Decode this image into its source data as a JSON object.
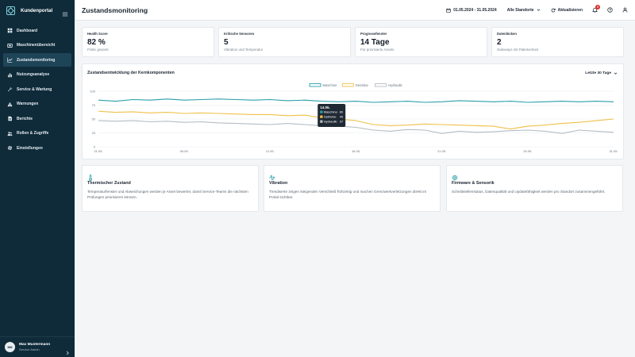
{
  "app": {
    "brand": "Kundenportal"
  },
  "sidebar": {
    "items": [
      {
        "label": "Dashboard",
        "icon": "grid-icon"
      },
      {
        "label": "Maschinenübersicht",
        "icon": "machine-icon"
      },
      {
        "label": "Zustandsmonitoring",
        "icon": "chart-line-icon"
      },
      {
        "label": "Nutzungsanalyse",
        "icon": "bar-chart-icon"
      },
      {
        "label": "Service & Wartung",
        "icon": "wrench-icon"
      },
      {
        "label": "Warnungen",
        "icon": "warning-icon"
      },
      {
        "label": "Berichte",
        "icon": "document-icon"
      },
      {
        "label": "Rollen & Zugriffe",
        "icon": "users-icon"
      },
      {
        "label": "Einstellungen",
        "icon": "gear-icon"
      }
    ],
    "active_index": 2,
    "user": {
      "initials": "MM",
      "name": "Max Mustermann",
      "role": "Service Admin"
    }
  },
  "header": {
    "title": "Zustandsmonitoring",
    "date_range": "01.05.2024 - 31.05.2024",
    "location": "Alle Standorte",
    "refresh": "Aktualisieren",
    "notifications": "3"
  },
  "kpis": [
    {
      "label": "Health Score",
      "value": "82 %",
      "sub": "Flotte gesamt"
    },
    {
      "label": "Kritische Sensoren",
      "value": "5",
      "sub": "Vibration und Temperatur"
    },
    {
      "label": "Prognosefenster",
      "value": "14 Tage",
      "sub": "Für priorisierte Assets"
    },
    {
      "label": "Datenlücken",
      "value": "2",
      "sub": "Gateways mit Paketverlust"
    }
  ],
  "chart_section": {
    "title": "Zustandsentwicklung der Kernkomponenten",
    "range": "Letzte 30 Tage"
  },
  "chart_data": {
    "type": "line",
    "title": "Zustandsentwicklung der Kernkomponenten",
    "x_ticks": [
      "01.05.",
      "06.05.",
      "11.05.",
      "16.05.",
      "21.05.",
      "26.05.",
      "31.05."
    ],
    "days": [
      1,
      2,
      3,
      4,
      5,
      6,
      7,
      8,
      9,
      10,
      11,
      12,
      13,
      14,
      15,
      16,
      17,
      18,
      19,
      20,
      21,
      22,
      23,
      24,
      25,
      26,
      27,
      28,
      29,
      30,
      31
    ],
    "ylim": [
      0,
      100
    ],
    "y_ticks": [
      0,
      25,
      50,
      75,
      100
    ],
    "grid": true,
    "legend_position": "top-center",
    "series": [
      {
        "name": "Maschine",
        "color": "#2a9fa8",
        "values": [
          84,
          82,
          85,
          84,
          86,
          84,
          85,
          86,
          85,
          84,
          85,
          83,
          84,
          82,
          81,
          82,
          80,
          81,
          82,
          80,
          81,
          83,
          82,
          81,
          82,
          80,
          81,
          82,
          81,
          82,
          81
        ]
      },
      {
        "name": "Getriebe",
        "color": "#efc14a",
        "values": [
          64,
          62,
          63,
          61,
          62,
          60,
          61,
          60,
          59,
          58,
          58,
          56,
          57,
          52,
          50,
          47,
          40,
          38,
          39,
          41,
          40,
          39,
          38,
          37,
          32,
          37,
          39,
          42,
          44,
          47,
          50
        ]
      },
      {
        "name": "Hydraulik",
        "color": "#b5bcc2",
        "values": [
          47,
          46,
          47,
          45,
          46,
          44,
          45,
          43,
          42,
          41,
          40,
          42,
          40,
          38,
          37,
          35,
          30,
          28,
          31,
          30,
          24,
          28,
          26,
          27,
          29,
          30,
          28,
          24,
          30,
          28,
          26
        ]
      }
    ],
    "tooltip": {
      "label": "14.05.",
      "rows": [
        {
          "name": "Maschine",
          "value": "80",
          "color": "#2a9fa8"
        },
        {
          "name": "Getriebe",
          "value": "49",
          "color": "#efc14a"
        },
        {
          "name": "Hydraulik",
          "value": "37",
          "color": "#b5bcc2"
        }
      ]
    }
  },
  "info_cards": [
    {
      "icon": "thermometer-icon",
      "title": "Thermischer Zustand",
      "text": "Temperaturfenster und Abweichungen werden je Asset bewertet, damit Service-Teams die nächsten Prüfungen priorisieren können."
    },
    {
      "icon": "waveform-icon",
      "title": "Vibration",
      "text": "Trendwerte zeigen steigenden Verschleiß frühzeitig und machen Grenzwertverletzungen direkt im Portal sichtbar."
    },
    {
      "icon": "chip-icon",
      "title": "Firmware & Sensorik",
      "text": "Schnittstellenstatus, Datenqualität und Updatefähigkeit werden pro Standort zusammengeführt."
    }
  ],
  "colors": {
    "sidebar": "#0f2b3a",
    "sidebar_active": "#1e4557",
    "accent": "#2a9fa8",
    "alert": "#d9302c"
  }
}
